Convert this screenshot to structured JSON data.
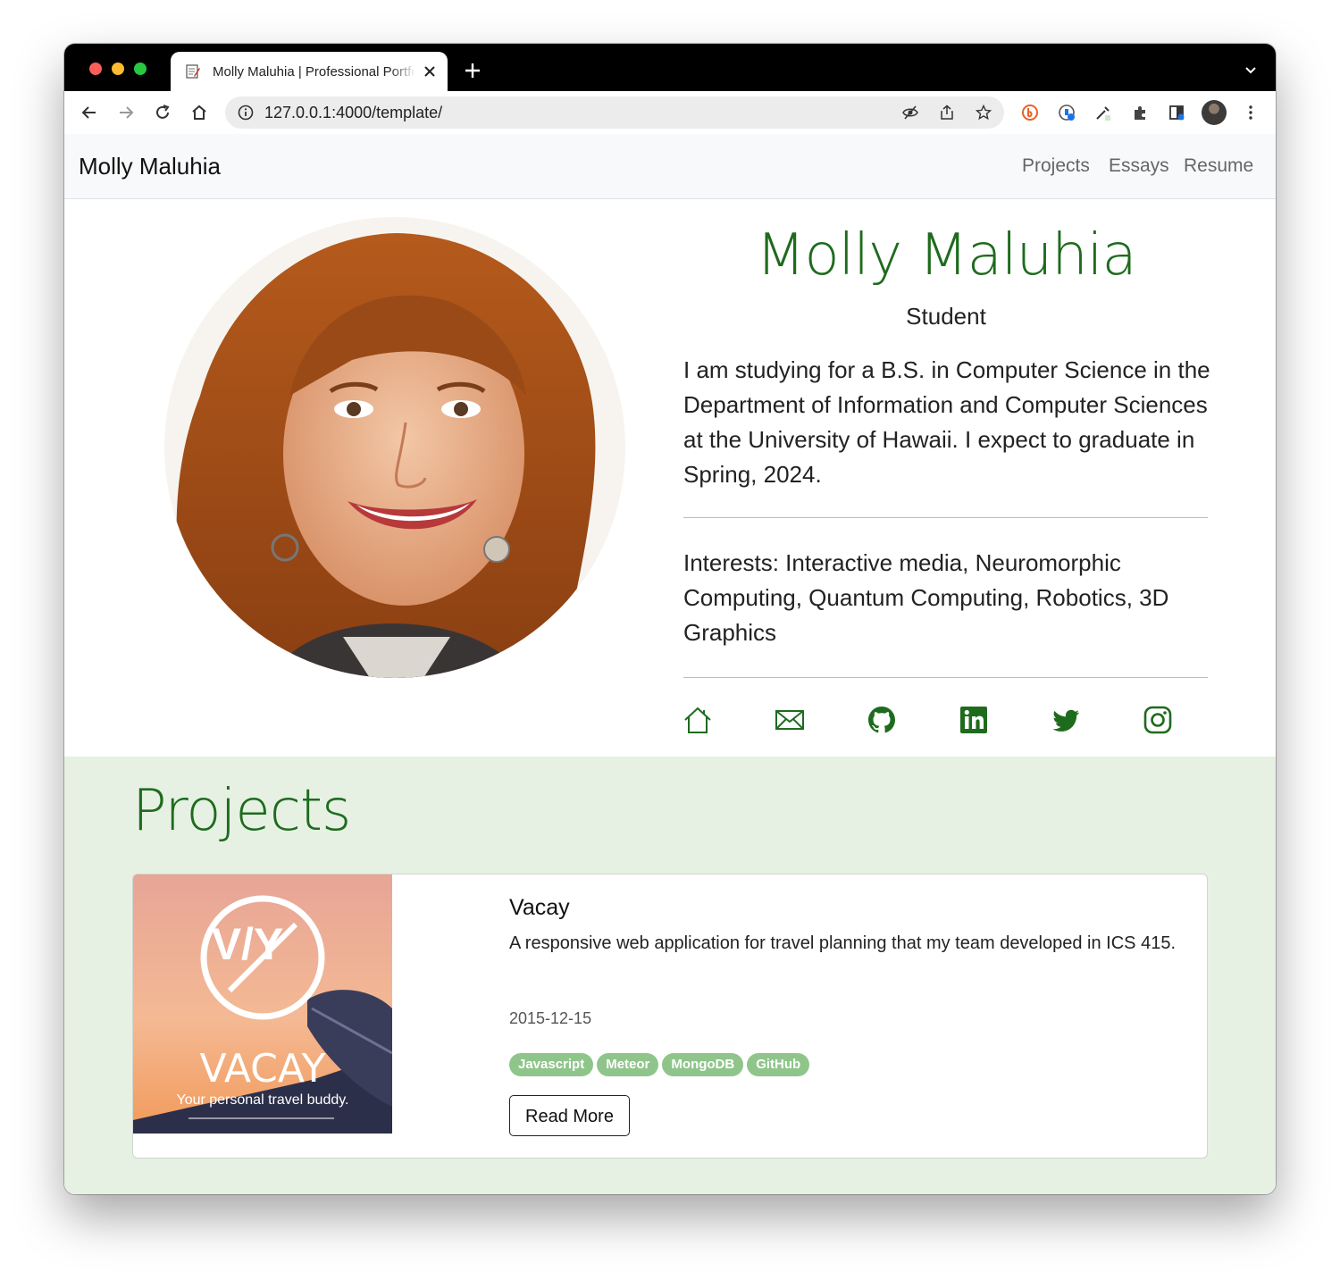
{
  "browser": {
    "tab_title": "Molly Maluhia | Professional Portfolio",
    "url": "127.0.0.1:4000/template/"
  },
  "nav": {
    "brand": "Molly Maluhia",
    "links": [
      "Projects",
      "Essays",
      "Resume"
    ]
  },
  "profile": {
    "name": "Molly Maluhia",
    "role": "Student",
    "bio": "I am studying for a B.S. in Computer Science in the Department of Information and Computer Sciences at the University of Hawaii. I expect to graduate in Spring, 2024.",
    "interests": "Interests: Interactive media, Neuromorphic Computing, Quantum Computing, Robotics, 3D Graphics",
    "social_icons": [
      "home-icon",
      "mail-icon",
      "github-icon",
      "linkedin-icon",
      "twitter-icon",
      "instagram-icon"
    ]
  },
  "projects": {
    "heading": "Projects",
    "items": [
      {
        "title": "Vacay",
        "image_text": {
          "logo_letters": "V/Y",
          "wordmark": "VACAY",
          "tagline": "Your personal travel buddy."
        },
        "description": "A responsive web application for travel planning that my team developed in ICS 415.",
        "date": "2015-12-15",
        "tags": [
          "Javascript",
          "Meteor",
          "MongoDB",
          "GitHub"
        ],
        "button": "Read More"
      }
    ]
  },
  "colors": {
    "accent_green": "#1e6b1e",
    "projects_bg": "#e6f1e3",
    "tag_green": "#8fc58b"
  }
}
